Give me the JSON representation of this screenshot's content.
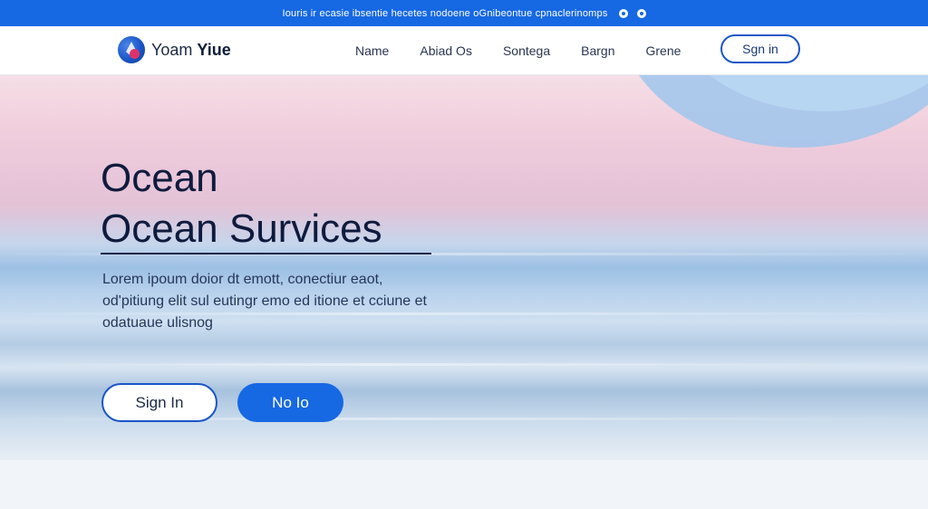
{
  "topbar": {
    "announcement": "Iouris ir ecasie ibsentie hecetes nodoene oGnibeontue cpnaclerinomps"
  },
  "brand": {
    "name_light": "Yoam ",
    "name_bold": "Yiue"
  },
  "nav": {
    "links": [
      "Name",
      "Abiad Os",
      "Sontega",
      "Bargn",
      "Grene"
    ],
    "signin_label": "Sgn in"
  },
  "hero": {
    "title_line1": "Ocean",
    "title_line2": "Ocean Survices",
    "description": "Lorem ipoum doior dt emott, conectiur eaot, od'pitiung elit  sul eutingr emo ed itione et cciune et odatuaue ulisnog",
    "primary_button": "Sign In",
    "secondary_button": "No Io"
  },
  "colors": {
    "accent": "#1668e3",
    "heading": "#0f1b3d"
  }
}
